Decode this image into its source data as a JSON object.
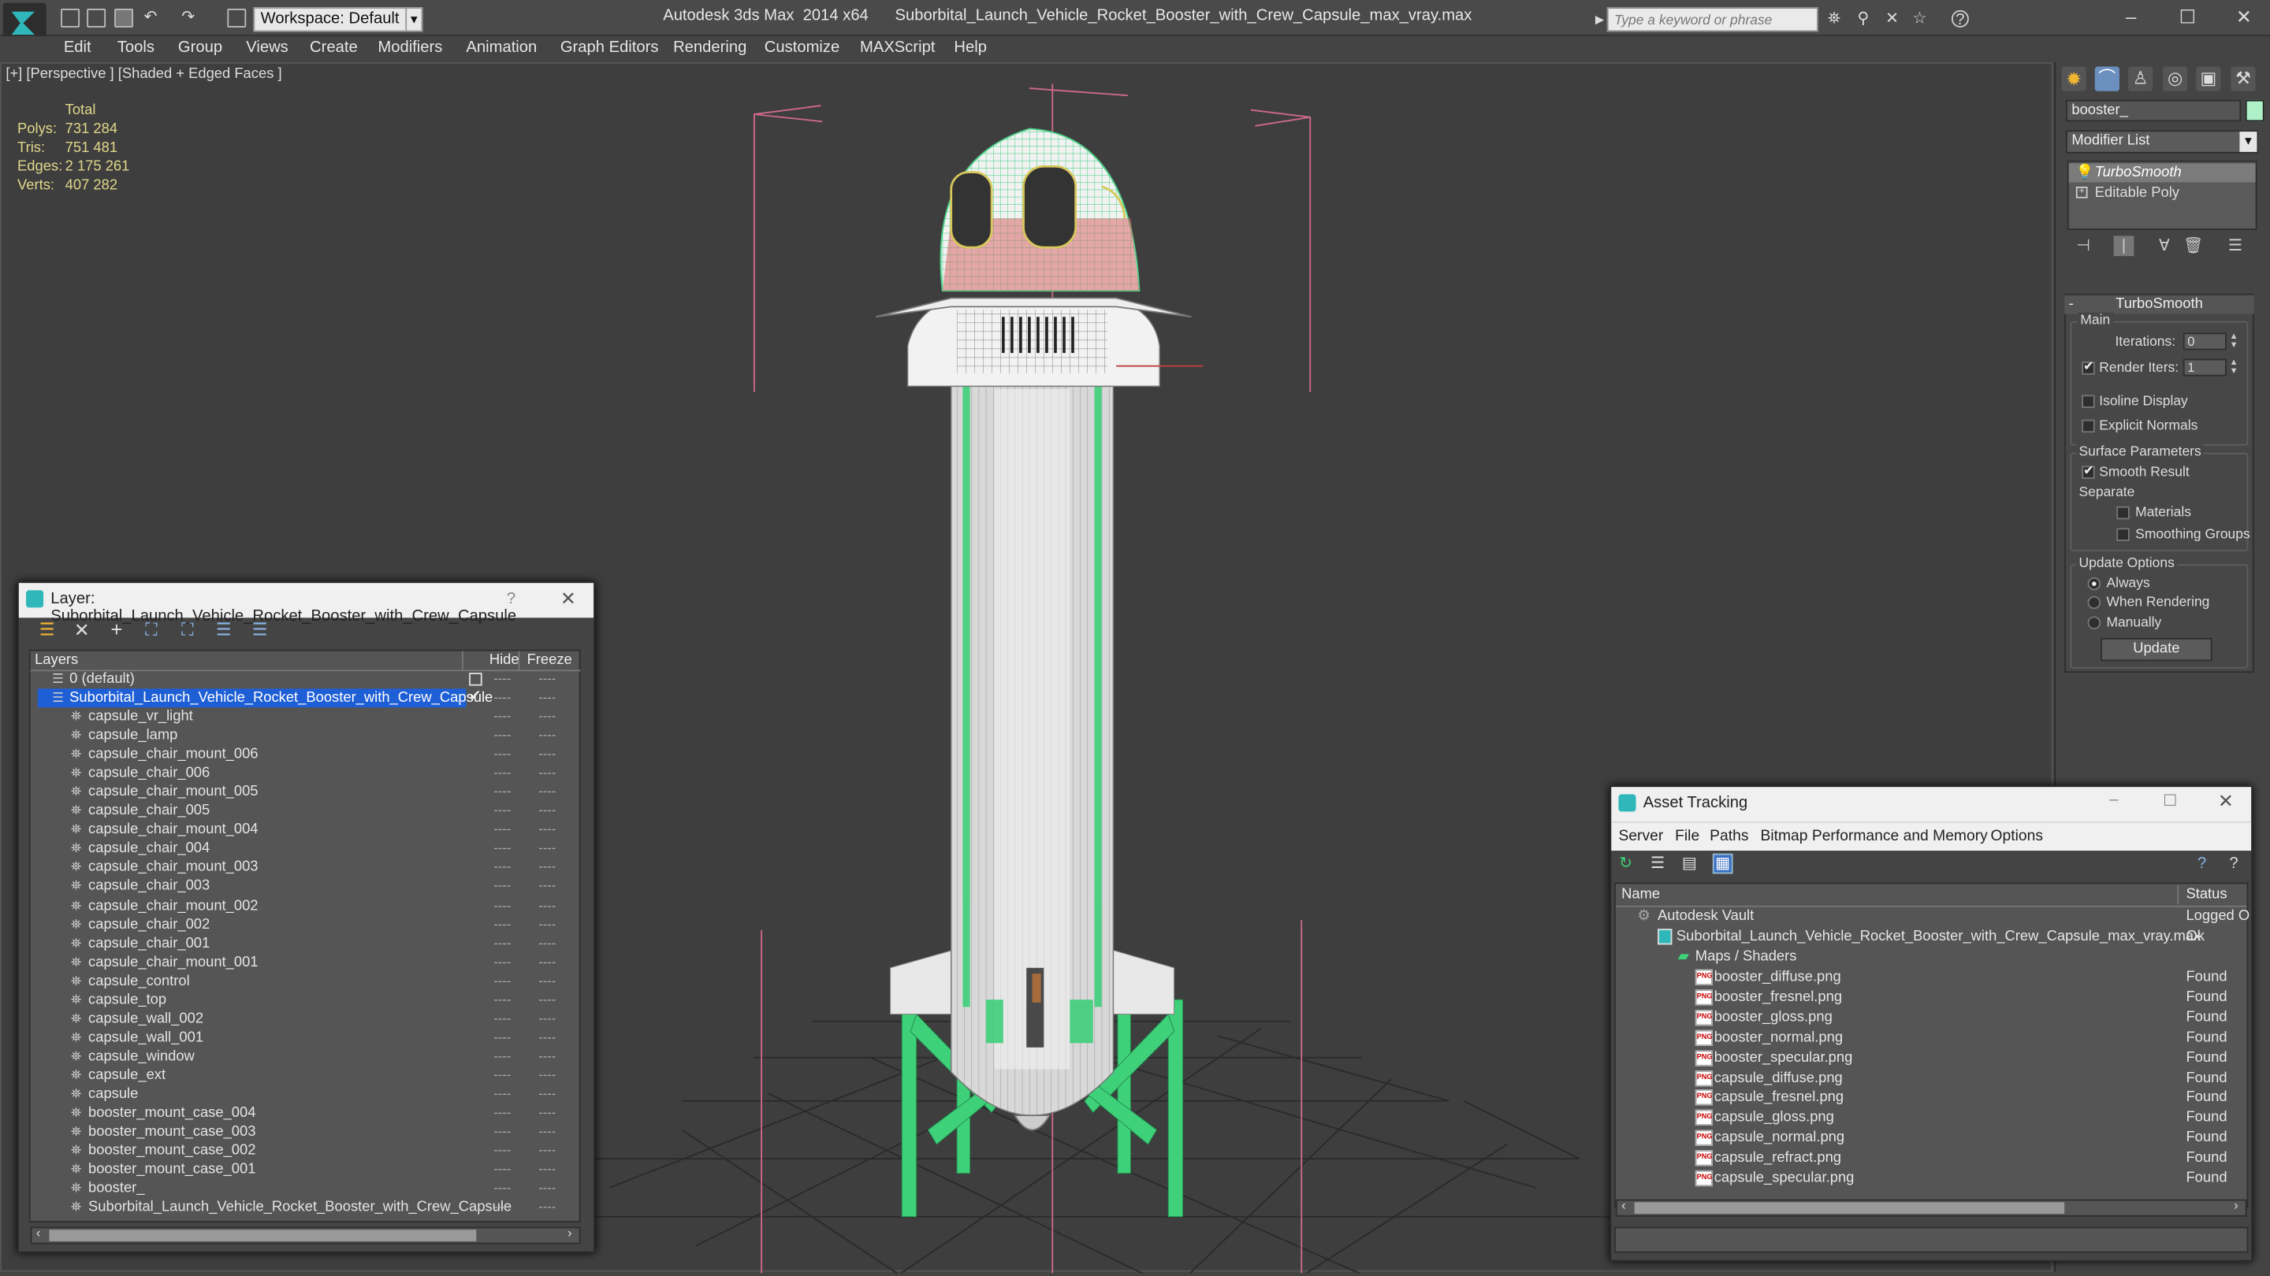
{
  "app": {
    "title": "Autodesk 3ds Max  2014 x64",
    "file": "Suborbital_Launch_Vehicle_Rocket_Booster_with_Crew_Capsule_max_vray.max",
    "workspace": "Workspace: Default",
    "search_placeholder": "Type a keyword or phrase"
  },
  "menu": [
    "Edit",
    "Tools",
    "Group",
    "Views",
    "Create",
    "Modifiers",
    "Animation",
    "Graph Editors",
    "Rendering",
    "Customize",
    "MAXScript",
    "Help"
  ],
  "viewport": {
    "label": "[+] [Perspective ] [Shaded + Edged Faces ]",
    "stats": {
      "header": "Total",
      "rows": [
        {
          "k": "Polys:",
          "v": "731 284"
        },
        {
          "k": "Tris:",
          "v": "751 481"
        },
        {
          "k": "Edges:",
          "v": "2 175 261"
        },
        {
          "k": "Verts:",
          "v": "407 282"
        }
      ]
    }
  },
  "command_panel": {
    "object_name": "booster_",
    "modifier_list": "Modifier List",
    "stack": [
      "TurboSmooth",
      "Editable Poly"
    ],
    "rollout_title": "TurboSmooth",
    "main_label": "Main",
    "iterations_label": "Iterations:",
    "iterations_value": "0",
    "render_iters_label": "Render Iters:",
    "render_iters_value": "1",
    "isoline_label": "Isoline Display",
    "explicit_label": "Explicit Normals",
    "surface_label": "Surface Parameters",
    "smooth_label": "Smooth Result",
    "separate_label": "Separate",
    "materials_label": "Materials",
    "smoothing_groups_label": "Smoothing Groups",
    "update_options_label": "Update Options",
    "always_label": "Always",
    "when_rendering_label": "When Rendering",
    "manually_label": "Manually",
    "update_button": "Update"
  },
  "layer_dialog": {
    "title": "Layer: Suborbital_Launch_Vehicle_Rocket_Booster_with_Crew_Capsule",
    "help": "?",
    "col_layers": "Layers",
    "col_hide": "Hide",
    "col_freeze": "Freeze",
    "default_layer": "0 (default)",
    "active_layer": "Suborbital_Launch_Vehicle_Rocket_Booster_with_Crew_Capsule",
    "objects": [
      "capsule_vr_light",
      "capsule_lamp",
      "capsule_chair_mount_006",
      "capsule_chair_006",
      "capsule_chair_mount_005",
      "capsule_chair_005",
      "capsule_chair_mount_004",
      "capsule_chair_004",
      "capsule_chair_mount_003",
      "capsule_chair_003",
      "capsule_chair_mount_002",
      "capsule_chair_002",
      "capsule_chair_001",
      "capsule_chair_mount_001",
      "capsule_control",
      "capsule_top",
      "capsule_wall_002",
      "capsule_wall_001",
      "capsule_window",
      "capsule_ext",
      "capsule",
      "booster_mount_case_004",
      "booster_mount_case_003",
      "booster_mount_case_002",
      "booster_mount_case_001",
      "booster_",
      "Suborbital_Launch_Vehicle_Rocket_Booster_with_Crew_Capsule"
    ],
    "dash": "----"
  },
  "asset_tracking": {
    "title": "Asset Tracking",
    "menu": [
      "Server",
      "File",
      "Paths",
      "Bitmap Performance and Memory",
      "Options"
    ],
    "col_name": "Name",
    "col_status": "Status",
    "vault": {
      "name": "Autodesk Vault",
      "status": "Logged O"
    },
    "file": {
      "name": "Suborbital_Launch_Vehicle_Rocket_Booster_with_Crew_Capsule_max_vray.max",
      "status": "Ok"
    },
    "folder": "Maps / Shaders",
    "maps": [
      {
        "name": "booster_diffuse.png",
        "status": "Found"
      },
      {
        "name": "booster_fresnel.png",
        "status": "Found"
      },
      {
        "name": "booster_gloss.png",
        "status": "Found"
      },
      {
        "name": "booster_normal.png",
        "status": "Found"
      },
      {
        "name": "booster_specular.png",
        "status": "Found"
      },
      {
        "name": "capsule_diffuse.png",
        "status": "Found"
      },
      {
        "name": "capsule_fresnel.png",
        "status": "Found"
      },
      {
        "name": "capsule_gloss.png",
        "status": "Found"
      },
      {
        "name": "capsule_normal.png",
        "status": "Found"
      },
      {
        "name": "capsule_refract.png",
        "status": "Found"
      },
      {
        "name": "capsule_specular.png",
        "status": "Found"
      }
    ],
    "png_tag": "PNG"
  },
  "colors": {
    "selection": "#1e5fd6",
    "wire_green": "#3fd07a",
    "stats_yellow": "#e0d78a"
  }
}
